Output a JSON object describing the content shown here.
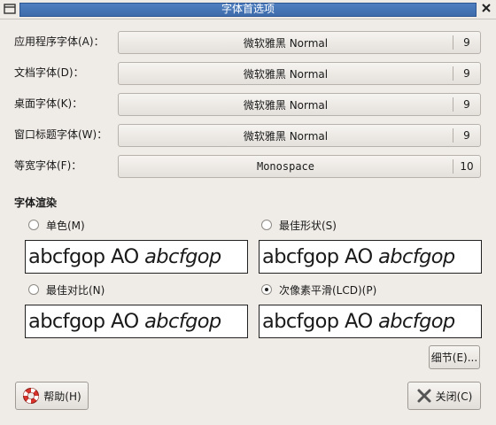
{
  "window": {
    "title": "字体首选项"
  },
  "fonts": [
    {
      "label": "应用程序字体(A)：",
      "font": "微软雅黑 Normal",
      "size": "9"
    },
    {
      "label": "文档字体(D)：",
      "font": "微软雅黑 Normal",
      "size": "9"
    },
    {
      "label": "桌面字体(K)：",
      "font": "微软雅黑 Normal",
      "size": "9"
    },
    {
      "label": "窗口标题字体(W)：",
      "font": "微软雅黑 Normal",
      "size": "9"
    },
    {
      "label": "等宽字体(F)：",
      "font": "Monospace",
      "size": "10"
    }
  ],
  "rendering": {
    "title": "字体渲染",
    "options": [
      {
        "label": "单色(M)",
        "selected": false
      },
      {
        "label": "最佳形状(S)",
        "selected": false
      },
      {
        "label": "最佳对比(N)",
        "selected": false
      },
      {
        "label": "次像素平滑(LCD)(P)",
        "selected": true
      }
    ],
    "sample_plain": "abcfgop AO ",
    "sample_italic": "abcfgop"
  },
  "buttons": {
    "details": "细节(E)...",
    "help": "帮助(H)",
    "close": "关闭(C)"
  },
  "icons": {
    "window_menu": "window-menu-icon",
    "close": "close-icon",
    "help": "lifebuoy-icon",
    "close_btn": "x-icon"
  }
}
